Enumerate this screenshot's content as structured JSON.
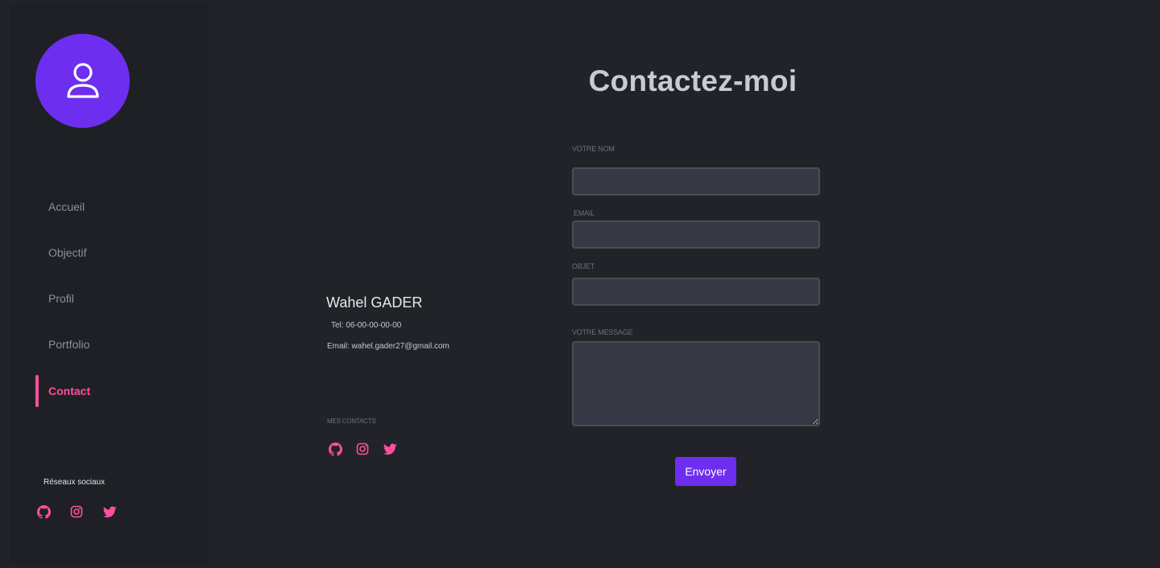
{
  "sidebar": {
    "nav": [
      {
        "label": "Accueil"
      },
      {
        "label": "Objectif"
      },
      {
        "label": "Profil"
      },
      {
        "label": "Portfolio"
      },
      {
        "label": "Contact",
        "active": true
      }
    ],
    "social_title": "Réseaux sociaux",
    "social_icons": [
      "github-icon",
      "instagram-icon",
      "twitter-icon"
    ]
  },
  "main": {
    "title": "Contactez-moi",
    "contact": {
      "name": "Wahel GADER",
      "tel": "Tel: 06-00-00-00-00",
      "email": "Email: wahel.gader27@gmail.com",
      "contacts_label": "MES CONTACTS",
      "social_icons": [
        "github-icon",
        "instagram-icon",
        "twitter-icon"
      ]
    },
    "form": {
      "name_label": "VOTRE NOM",
      "name_value": "",
      "email_label": "EMAIL",
      "email_value": "",
      "subject_label": "OBJET",
      "subject_value": "",
      "message_label": "VOTRE MESSAGE",
      "message_value": "",
      "submit_label": "Envoyer"
    }
  },
  "colors": {
    "background": "#212329",
    "sidebar": "#1e2026",
    "accent_purple": "#6d2ef0",
    "accent_pink": "#ff4f9f",
    "field_bg": "#363844"
  }
}
